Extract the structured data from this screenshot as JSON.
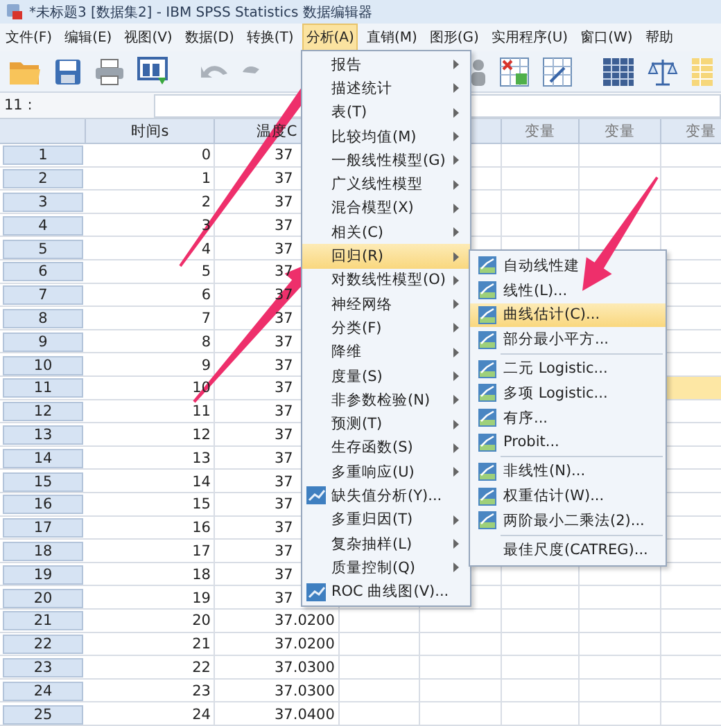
{
  "window": {
    "title": "*未标题3 [数据集2] - IBM SPSS Statistics 数据编辑器"
  },
  "menu_bar": [
    {
      "label": "文件(F)",
      "selected": false
    },
    {
      "label": "编辑(E)",
      "selected": false
    },
    {
      "label": "视图(V)",
      "selected": false
    },
    {
      "label": "数据(D)",
      "selected": false
    },
    {
      "label": "转换(T)",
      "selected": false
    },
    {
      "label": "分析(A)",
      "selected": true
    },
    {
      "label": "直销(M)",
      "selected": false
    },
    {
      "label": "图形(G)",
      "selected": false
    },
    {
      "label": "实用程序(U)",
      "selected": false
    },
    {
      "label": "窗口(W)",
      "selected": false
    },
    {
      "label": "帮助",
      "selected": false
    }
  ],
  "cell_ref": {
    "label": "11 :"
  },
  "table": {
    "columns": [
      {
        "kind": "data",
        "label": "时间s"
      },
      {
        "kind": "data",
        "label": "温度C"
      },
      {
        "kind": "hidden"
      },
      {
        "kind": "hidden"
      },
      {
        "kind": "var",
        "label": "变量"
      },
      {
        "kind": "var",
        "label": "变量"
      },
      {
        "kind": "var",
        "label": "变量"
      }
    ],
    "rows": [
      {
        "num": "1",
        "cells": [
          "0",
          "37"
        ],
        "selected": false
      },
      {
        "num": "2",
        "cells": [
          "1",
          "37"
        ],
        "selected": false
      },
      {
        "num": "3",
        "cells": [
          "2",
          "37"
        ],
        "selected": false
      },
      {
        "num": "4",
        "cells": [
          "3",
          "37"
        ],
        "selected": false
      },
      {
        "num": "5",
        "cells": [
          "4",
          "37"
        ],
        "selected": false
      },
      {
        "num": "6",
        "cells": [
          "5",
          "37"
        ],
        "selected": false
      },
      {
        "num": "7",
        "cells": [
          "6",
          "37"
        ],
        "selected": false
      },
      {
        "num": "8",
        "cells": [
          "7",
          "37"
        ],
        "selected": false
      },
      {
        "num": "9",
        "cells": [
          "8",
          "37"
        ],
        "selected": false
      },
      {
        "num": "10",
        "cells": [
          "9",
          "37"
        ],
        "selected": false
      },
      {
        "num": "11",
        "cells": [
          "10",
          "37"
        ],
        "selected": true
      },
      {
        "num": "12",
        "cells": [
          "11",
          "37"
        ],
        "selected": false
      },
      {
        "num": "13",
        "cells": [
          "12",
          "37"
        ],
        "selected": false
      },
      {
        "num": "14",
        "cells": [
          "13",
          "37"
        ],
        "selected": false
      },
      {
        "num": "15",
        "cells": [
          "14",
          "37"
        ],
        "selected": false
      },
      {
        "num": "16",
        "cells": [
          "15",
          "37"
        ],
        "selected": false
      },
      {
        "num": "17",
        "cells": [
          "16",
          "37"
        ],
        "selected": false
      },
      {
        "num": "18",
        "cells": [
          "17",
          "37"
        ],
        "selected": false
      },
      {
        "num": "19",
        "cells": [
          "18",
          "37"
        ],
        "selected": false
      },
      {
        "num": "20",
        "cells": [
          "19",
          "37"
        ],
        "selected": false
      },
      {
        "num": "21",
        "cells": [
          "20",
          "37.0200"
        ],
        "selected": false
      },
      {
        "num": "22",
        "cells": [
          "21",
          "37.0200"
        ],
        "selected": false
      },
      {
        "num": "23",
        "cells": [
          "22",
          "37.0300"
        ],
        "selected": false
      },
      {
        "num": "24",
        "cells": [
          "23",
          "37.0300"
        ],
        "selected": false
      },
      {
        "num": "25",
        "cells": [
          "24",
          "37.0400"
        ],
        "selected": false
      }
    ]
  },
  "analyze_menu": {
    "items": [
      {
        "label": "报告",
        "kind": "submenu",
        "selected": false
      },
      {
        "label": "描述统计",
        "kind": "submenu",
        "selected": false
      },
      {
        "label": "表(T)",
        "kind": "submenu",
        "selected": false
      },
      {
        "label": "比较均值(M)",
        "kind": "submenu",
        "selected": false
      },
      {
        "label": "一般线性模型(G)",
        "kind": "submenu",
        "selected": false
      },
      {
        "label": "广义线性模型",
        "kind": "submenu",
        "selected": false
      },
      {
        "label": "混合模型(X)",
        "kind": "submenu",
        "selected": false
      },
      {
        "label": "相关(C)",
        "kind": "submenu",
        "selected": false
      },
      {
        "label": "回归(R)",
        "kind": "submenu",
        "selected": true
      },
      {
        "label": "对数线性模型(O)",
        "kind": "submenu",
        "selected": false
      },
      {
        "label": "神经网络",
        "kind": "submenu",
        "selected": false
      },
      {
        "label": "分类(F)",
        "kind": "submenu",
        "selected": false
      },
      {
        "label": "降维",
        "kind": "submenu",
        "selected": false
      },
      {
        "label": "度量(S)",
        "kind": "submenu",
        "selected": false
      },
      {
        "label": "非参数检验(N)",
        "kind": "submenu",
        "selected": false
      },
      {
        "label": "预测(T)",
        "kind": "submenu",
        "selected": false
      },
      {
        "label": "生存函数(S)",
        "kind": "submenu",
        "selected": false
      },
      {
        "label": "多重响应(U)",
        "kind": "submenu",
        "selected": false
      },
      {
        "label": "缺失值分析(Y)...",
        "kind": "action",
        "selected": false
      },
      {
        "label": "多重归因(T)",
        "kind": "submenu",
        "selected": false
      },
      {
        "label": "复杂抽样(L)",
        "kind": "submenu",
        "selected": false
      },
      {
        "label": "质量控制(Q)",
        "kind": "submenu",
        "selected": false
      },
      {
        "label": "ROC 曲线图(V)...",
        "kind": "action",
        "selected": false
      }
    ]
  },
  "regression_submenu": {
    "items": [
      {
        "label": "自动线性建",
        "kind": "action",
        "selected": false
      },
      {
        "label": "线性(L)...",
        "kind": "action",
        "selected": false
      },
      {
        "label": "曲线估计(C)...",
        "kind": "action",
        "selected": true
      },
      {
        "label": "部分最小平方...",
        "kind": "action",
        "selected": false
      },
      {
        "kind": "separator"
      },
      {
        "label": "二元 Logistic...",
        "kind": "action",
        "selected": false
      },
      {
        "label": "多项 Logistic...",
        "kind": "action",
        "selected": false
      },
      {
        "label": "有序...",
        "kind": "action",
        "selected": false
      },
      {
        "label": "Probit...",
        "kind": "action",
        "selected": false
      },
      {
        "kind": "separator"
      },
      {
        "label": "非线性(N)...",
        "kind": "action",
        "selected": false
      },
      {
        "label": "权重估计(W)...",
        "kind": "action",
        "selected": false
      },
      {
        "label": "两阶最小二乘法(2)...",
        "kind": "action",
        "selected": false
      },
      {
        "kind": "separator"
      },
      {
        "label": "最佳尺度(CATREG)...",
        "kind": "plain",
        "selected": false
      }
    ]
  }
}
